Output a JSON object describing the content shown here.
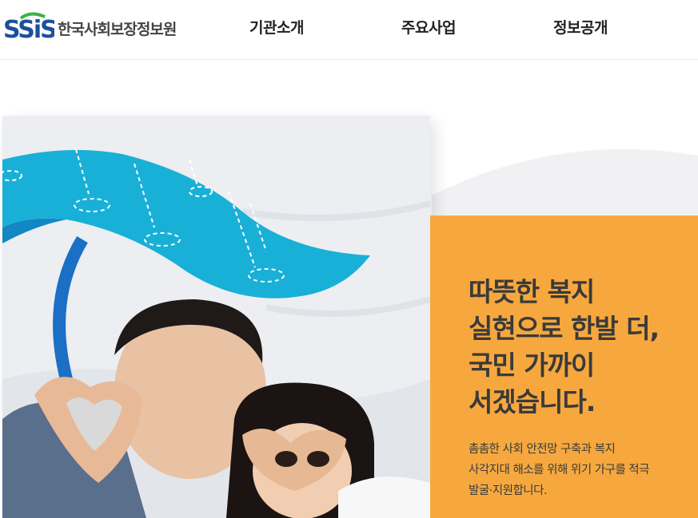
{
  "brand": {
    "logo_mark": "SSiS",
    "name": "한국사회보장정보원",
    "colors": {
      "blue": "#1d4f9c",
      "green": "#3ab54a",
      "orange": "#f6a83e",
      "wave": "#19b0d8"
    }
  },
  "nav": {
    "items": [
      {
        "label": "기관소개"
      },
      {
        "label": "주요사업"
      },
      {
        "label": "정보공개"
      }
    ]
  },
  "hero": {
    "headline": [
      "따뜻한 복지",
      "실현으로 한발 더,",
      "국민 가까이",
      "서겠습니다."
    ],
    "description": [
      "촘촘한 사회 안전망 구축과 복지",
      "사각지대 해소를 위해 위기 가구를 적극",
      "발굴·지원합니다."
    ],
    "image": "photo of father and daughter making heart hand shapes under a blue wave canopy with raindrops"
  }
}
